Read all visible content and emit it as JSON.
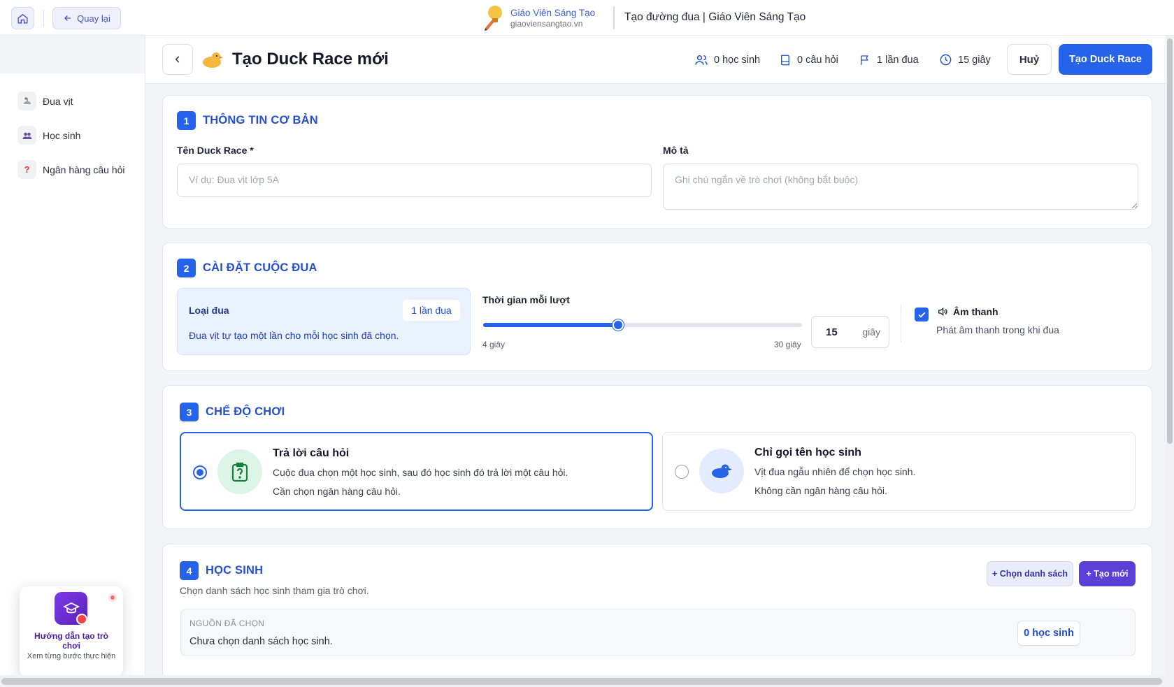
{
  "topbar": {
    "back_label": "Quay lại",
    "brand_name": "Giáo Viên Sáng Tạo",
    "brand_url": "giaoviensangtao.vn",
    "page_heading": "Tạo đường đua | Giáo Viên Sáng Tạo"
  },
  "sidebar": {
    "items": [
      {
        "label": "Đua vịt",
        "icon": "duck-icon"
      },
      {
        "label": "Học sinh",
        "icon": "students-icon"
      },
      {
        "label": "Ngân hàng câu hỏi",
        "icon": "question-icon"
      }
    ]
  },
  "header": {
    "title": "Tạo Duck Race mới",
    "stats": {
      "students": "0 học sinh",
      "questions": "0 câu hỏi",
      "races": "1 lần đua",
      "time": "15 giây"
    },
    "cancel_label": "Huỷ",
    "create_label": "Tạo Duck Race"
  },
  "section1": {
    "num": "1",
    "title": "THÔNG TIN CƠ BẢN",
    "name_label": "Tên Duck Race *",
    "name_placeholder": "Ví dụ: Đua vịt lớp 5A",
    "desc_label": "Mô tả",
    "desc_placeholder": "Ghi chú ngắn về trò chơi (không bắt buộc)"
  },
  "section2": {
    "num": "2",
    "title": "CÀI ĐẶT CUỘC ĐUA",
    "race_type_label": "Loại đua",
    "race_type_value": "1 lần đua",
    "race_type_desc": "Đua vịt tự tạo một lần cho mỗi học sinh đã chọn.",
    "time_label": "Thời gian mỗi lượt",
    "time_min": "4 giây",
    "time_max": "30 giây",
    "time_value": "15",
    "time_unit": "giây",
    "slider": {
      "min": 4,
      "max": 30,
      "value": 15
    },
    "sound_label": "Âm thanh",
    "sound_desc": "Phát âm thanh trong khi đua",
    "sound_checked": true
  },
  "section3": {
    "num": "3",
    "title": "CHẾ ĐỘ CHƠI",
    "modes": [
      {
        "title": "Trả lời câu hỏi",
        "line1": "Cuộc đua chọn một học sinh, sau đó học sinh đó trả lời một câu hỏi.",
        "line2": "Cần chọn ngân hàng câu hỏi.",
        "selected": true
      },
      {
        "title": "Chỉ gọi tên học sinh",
        "line1": "Vịt đua ngẫu nhiên để chọn học sinh.",
        "line2": "Không cần ngân hàng câu hỏi.",
        "selected": false
      }
    ]
  },
  "section4": {
    "num": "4",
    "title": "HỌC SINH",
    "subtitle": "Chọn danh sách học sinh tham gia trò chơi.",
    "choose_list_label": "+ Chọn danh sách",
    "create_new_label": "+ Tạo mới",
    "source_caption": "NGUỒN ĐÃ CHỌN",
    "source_text": "Chưa chọn danh sách học sinh.",
    "source_count": "0 học sinh"
  },
  "guide": {
    "title": "Hướng dẫn tạo trò chơi",
    "subtitle": "Xem từng bước thực hiện"
  },
  "colors": {
    "accent": "#2563eb",
    "accent_purple": "#6d28d9",
    "section_title": "#2450d0"
  }
}
